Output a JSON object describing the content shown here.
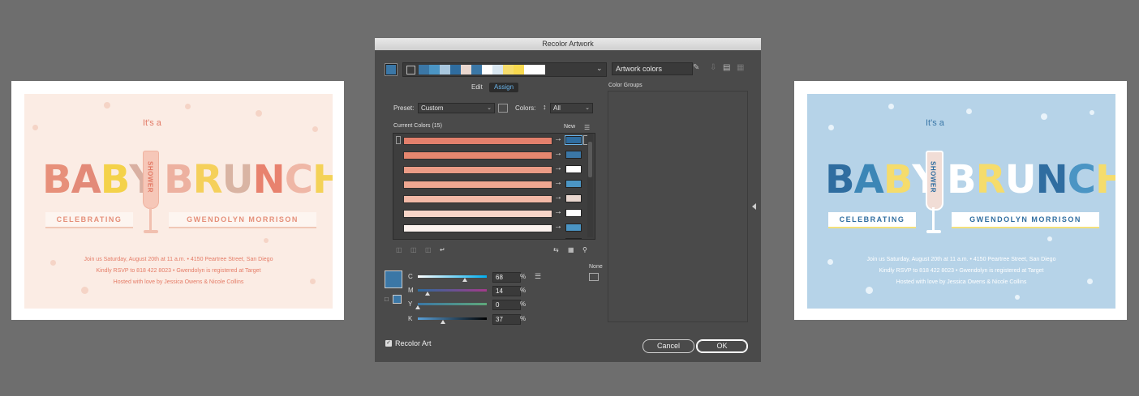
{
  "left_card": {
    "its_a": "It's a",
    "baby_letters": [
      {
        "ch": "B",
        "color": "#e7907a"
      },
      {
        "ch": "A",
        "color": "#e38a78"
      },
      {
        "ch": "B",
        "color": "#f4d24a"
      },
      {
        "ch": "Y",
        "color": "#d9b0a2"
      }
    ],
    "brunch_letters": [
      {
        "ch": "B",
        "color": "#edb1a0"
      },
      {
        "ch": "R",
        "color": "#f5d05b"
      },
      {
        "ch": "U",
        "color": "#d9b4a3"
      },
      {
        "ch": "N",
        "color": "#e8826e"
      },
      {
        "ch": "C",
        "color": "#efb7a6"
      },
      {
        "ch": "H",
        "color": "#f4d257"
      }
    ],
    "shower": "SHOWER",
    "banner_left": "CELEBRATING",
    "banner_right": "GWENDOLYN MORRISON",
    "line1": "Join us Saturday, August 20th at 11 a.m. • 4150 Peartree Street, San Diego",
    "line2": "Kindly RSVP to 818 422 8023 • Gwendolyn is registered at Target",
    "line3": "Hosted with love by Jessica Owens & Nicole Collins"
  },
  "right_card": {
    "its_a": "It's a",
    "baby_letters": [
      {
        "ch": "B",
        "color": "#2f6da0"
      },
      {
        "ch": "A",
        "color": "#3c86b6"
      },
      {
        "ch": "B",
        "color": "#f5dc6c"
      },
      {
        "ch": "Y",
        "color": "#ffffff"
      }
    ],
    "brunch_letters": [
      {
        "ch": "B",
        "color": "#ffffff"
      },
      {
        "ch": "R",
        "color": "#f5dc6c"
      },
      {
        "ch": "U",
        "color": "#ffffff"
      },
      {
        "ch": "N",
        "color": "#2f6da0"
      },
      {
        "ch": "C",
        "color": "#4b95c4"
      },
      {
        "ch": "H",
        "color": "#f5dc6c"
      }
    ],
    "shower": "SHOWER",
    "banner_left": "CELEBRATING",
    "banner_right": "GWENDOLYN MORRISON",
    "line1": "Join us Saturday, August 20th at 11 a.m. • 4150 Peartree Street, San Diego",
    "line2": "Kindly RSVP to 818 422 8023 • Gwendolyn is registered at Target",
    "line3": "Hosted with love by Jessica Owens & Nicole Collins"
  },
  "dialog": {
    "title": "Recolor Artwork",
    "color_name": "Artwork colors",
    "strip_colors": [
      "#3b77a6",
      "#4b95c4",
      "#a8c7de",
      "#2f6da0",
      "#e9d7cf",
      "#3b77a6",
      "#ffffff",
      "#d8e6f0",
      "#f5dc6c",
      "#f7d94f",
      "#ffffff",
      "#ffffff"
    ],
    "tab_edit": "Edit",
    "tab_assign": "Assign",
    "color_groups": "Color Groups",
    "preset_label": "Preset:",
    "preset_value": "Custom",
    "colors_label": "Colors:",
    "colors_value": "All",
    "current_colors": "Current Colors (15)",
    "new_label": "New",
    "rows": [
      {
        "current": "#e3806c",
        "new": "#2f6da0",
        "selected": true
      },
      {
        "current": "#e6876f",
        "new": "#3b77a6",
        "selected": false
      },
      {
        "current": "#eb9c86",
        "new": "#ffffff",
        "selected": false
      },
      {
        "current": "#eea791",
        "new": "#4b95c4",
        "selected": false
      },
      {
        "current": "#f2b9a7",
        "new": "#e9d7cf",
        "selected": false
      },
      {
        "current": "#f7d5c8",
        "new": "#ffffff",
        "selected": false
      },
      {
        "current": "#fbf2ee",
        "new": "#4b95c4",
        "selected": false
      },
      {
        "current": "#ffffff",
        "new": "#3b77a6",
        "selected": false
      }
    ],
    "sliders": [
      {
        "label": "C",
        "value": "68",
        "pct": 0.68
      },
      {
        "label": "M",
        "value": "14",
        "pct": 0.14
      },
      {
        "label": "Y",
        "value": "0",
        "pct": 0.0
      },
      {
        "label": "K",
        "value": "37",
        "pct": 0.37
      }
    ],
    "percent": "%",
    "none_label": "None",
    "recolor_art": "Recolor Art",
    "cancel": "Cancel",
    "ok": "OK"
  }
}
